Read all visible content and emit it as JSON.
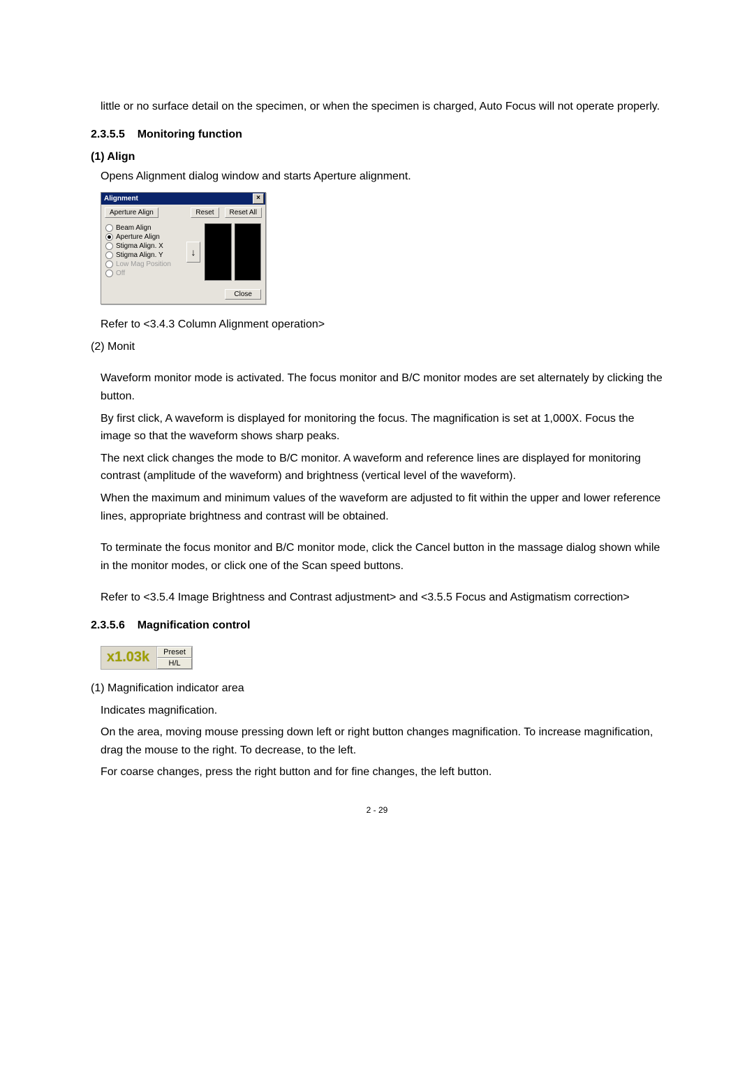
{
  "intro": {
    "p1": "little or no surface detail on the specimen, or when the specimen is charged, Auto Focus will not operate properly."
  },
  "sec235_5": {
    "num": "2.3.5.5",
    "title": "Monitoring function",
    "item1": {
      "heading": "(1) Align",
      "desc": "Opens Alignment dialog window and starts Aperture alignment.",
      "ref": "Refer to <3.4.3 Column Alignment operation>"
    },
    "item2": {
      "heading": "(2) Monit",
      "p1": "Waveform monitor mode is activated. The focus monitor and B/C monitor modes are set alternately by clicking the button.",
      "p2": "By first click, A waveform is displayed for monitoring the focus.    The magnification is set at 1,000X.    Focus the image so that the waveform shows sharp peaks.",
      "p3": "The next click changes the mode to B/C monitor. A waveform and reference lines are displayed for monitoring contrast (amplitude of the waveform) and brightness (vertical level of the waveform).",
      "p4": "When the maximum and minimum values of the waveform are adjusted to fit within the upper and lower reference lines, appropriate brightness and contrast will be obtained.",
      "p5": "To terminate the focus monitor and B/C monitor mode, click the Cancel button in the massage dialog shown while in the monitor modes, or click one of the Scan speed buttons.",
      "p6": "Refer to <3.5.4 Image Brightness and Contrast adjustment> and <3.5.5 Focus and Astigmatism correction>"
    }
  },
  "alignment_dialog": {
    "title": "Alignment",
    "current_mode_btn": "Aperture Align",
    "reset": "Reset",
    "reset_all": "Reset All",
    "options": {
      "beam": "Beam  Align",
      "aperture": "Aperture Align",
      "stigx": "Stigma Align. X",
      "stigy": "Stigma Align. Y",
      "lowmag": "Low Mag Position",
      "off": "Off"
    },
    "arrow": "↓",
    "close": "Close",
    "close_x": "×"
  },
  "sec235_6": {
    "num": "2.3.5.6",
    "title": "Magnification control",
    "mag_display": "x1.03k",
    "preset": "Preset",
    "hl": "H/L",
    "item1": {
      "heading": "(1) Magnification indicator area",
      "l1": "Indicates magnification.",
      "l2": "On the area, moving mouse pressing down left or right button changes magnification. To increase magnification, drag the mouse to the right. To decrease, to the left.",
      "l3": "For coarse changes, press the right button and for fine changes, the left button."
    }
  },
  "page_number": "2 - 29"
}
